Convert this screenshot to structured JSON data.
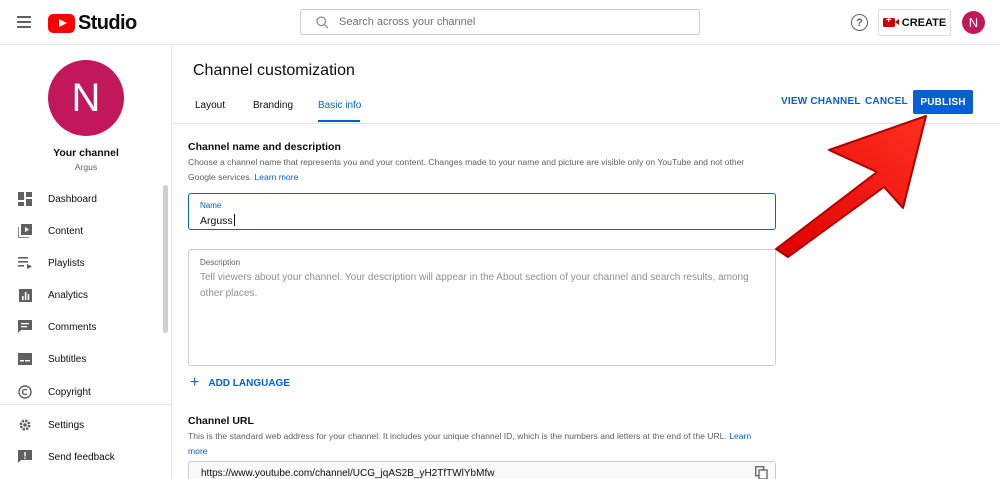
{
  "header": {
    "logo_text": "Studio",
    "search_placeholder": "Search across your channel",
    "help_symbol": "?",
    "create_label": "CREATE",
    "avatar_letter": "N"
  },
  "sidebar": {
    "avatar_letter": "N",
    "channel_title": "Your channel",
    "channel_name": "Argus",
    "items": [
      {
        "label": "Dashboard",
        "icon": "dashboard-icon"
      },
      {
        "label": "Content",
        "icon": "content-icon"
      },
      {
        "label": "Playlists",
        "icon": "playlists-icon"
      },
      {
        "label": "Analytics",
        "icon": "analytics-icon"
      },
      {
        "label": "Comments",
        "icon": "comments-icon"
      },
      {
        "label": "Subtitles",
        "icon": "subtitles-icon"
      },
      {
        "label": "Copyright",
        "icon": "copyright-icon"
      },
      {
        "label": "Settings",
        "icon": "gear-icon"
      },
      {
        "label": "Send feedback",
        "icon": "feedback-icon"
      }
    ]
  },
  "main": {
    "title": "Channel customization",
    "tabs": [
      {
        "label": "Layout",
        "active": false
      },
      {
        "label": "Branding",
        "active": false
      },
      {
        "label": "Basic info",
        "active": true
      }
    ],
    "actions": {
      "view_channel": "VIEW CHANNEL",
      "cancel": "CANCEL",
      "publish": "PUBLISH"
    },
    "name_section": {
      "title": "Channel name and description",
      "desc": "Choose a channel name that represents you and your content. Changes made to your name and picture are visible only on YouTube and not other Google services.",
      "learn_more": "Learn more"
    },
    "name_field": {
      "label": "Name",
      "value": "Arguss"
    },
    "description_field": {
      "label": "Description",
      "placeholder": "Tell viewers about your channel. Your description will appear in the About section of your channel and search results, among other places."
    },
    "add_language": "ADD LANGUAGE",
    "url_section": {
      "title": "Channel URL",
      "desc": "This is the standard web address for your channel. It includes your unique channel ID, which is the numbers and letters at the end of the URL.",
      "learn_more": "Learn more",
      "value": "https://www.youtube.com/channel/UCG_jqAS2B_yH2TfTWlYbMfw"
    }
  },
  "colors": {
    "accent": "#065fd4",
    "brand_red": "#ff0000",
    "avatar": "#c2185b",
    "annotation_arrow": "#ff0000"
  }
}
